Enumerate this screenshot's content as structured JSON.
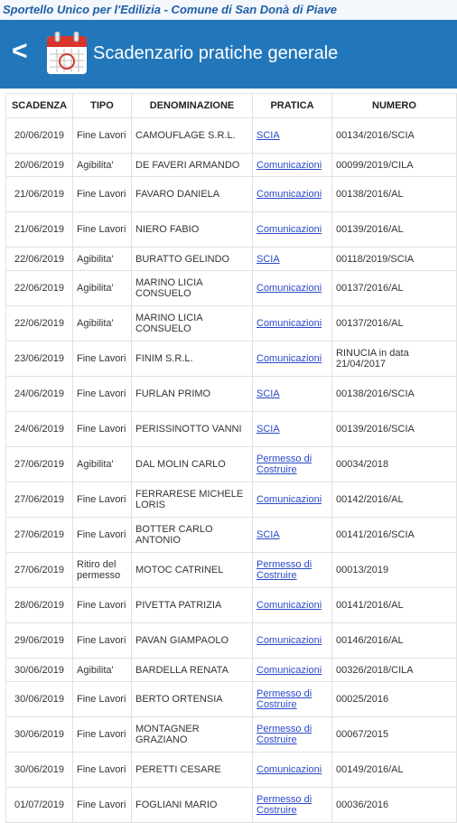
{
  "topbar": {
    "title": "Sportello Unico per l'Edilizia - Comune di San Donà di Piave"
  },
  "header": {
    "back_label": "<",
    "title": "Scadenzario pratiche generale"
  },
  "table": {
    "headers": [
      "SCADENZA",
      "TIPO",
      "DENOMINAZIONE",
      "PRATICA",
      "NUMERO"
    ],
    "rows": [
      {
        "scadenza": "20/06/2019",
        "tipo": "Fine Lavori",
        "denominazione": "CAMOUFLAGE S.R.L.",
        "pratica": "SCIA",
        "numero": "00134/2016/SCIA"
      },
      {
        "scadenza": "20/06/2019",
        "tipo": "Agibilita'",
        "denominazione": "DE FAVERI ARMANDO",
        "pratica": "Comunicazioni",
        "numero": "00099/2019/CILA"
      },
      {
        "scadenza": "21/06/2019",
        "tipo": "Fine Lavori",
        "denominazione": "FAVARO DANIELA",
        "pratica": "Comunicazioni",
        "numero": "00138/2016/AL"
      },
      {
        "scadenza": "21/06/2019",
        "tipo": "Fine Lavori",
        "denominazione": "NIERO FABIO",
        "pratica": "Comunicazioni",
        "numero": "00139/2016/AL"
      },
      {
        "scadenza": "22/06/2019",
        "tipo": "Agibilita'",
        "denominazione": "BURATTO GELINDO",
        "pratica": "SCIA",
        "numero": "00118/2019/SCIA"
      },
      {
        "scadenza": "22/06/2019",
        "tipo": "Agibilita'",
        "denominazione": "MARINO LICIA CONSUELO",
        "pratica": "Comunicazioni",
        "numero": "00137/2016/AL"
      },
      {
        "scadenza": "22/06/2019",
        "tipo": "Agibilita'",
        "denominazione": "MARINO LICIA CONSUELO",
        "pratica": "Comunicazioni",
        "numero": "00137/2016/AL"
      },
      {
        "scadenza": "23/06/2019",
        "tipo": "Fine Lavori",
        "denominazione": "FINIM S.R.L.",
        "pratica": "Comunicazioni",
        "numero": "RINUCIA in data 21/04/2017"
      },
      {
        "scadenza": "24/06/2019",
        "tipo": "Fine Lavori",
        "denominazione": "FURLAN PRIMO",
        "pratica": "SCIA",
        "numero": "00138/2016/SCIA"
      },
      {
        "scadenza": "24/06/2019",
        "tipo": "Fine Lavori",
        "denominazione": "PERISSINOTTO VANNI",
        "pratica": "SCIA",
        "numero": "00139/2016/SCIA"
      },
      {
        "scadenza": "27/06/2019",
        "tipo": "Agibilita'",
        "denominazione": "DAL MOLIN CARLO",
        "pratica": "Permesso di Costruire",
        "numero": "00034/2018"
      },
      {
        "scadenza": "27/06/2019",
        "tipo": "Fine Lavori",
        "denominazione": "FERRARESE MICHELE LORIS",
        "pratica": "Comunicazioni",
        "numero": "00142/2016/AL"
      },
      {
        "scadenza": "27/06/2019",
        "tipo": "Fine Lavori",
        "denominazione": "BOTTER CARLO ANTONIO",
        "pratica": "SCIA",
        "numero": "00141/2016/SCIA"
      },
      {
        "scadenza": "27/06/2019",
        "tipo": "Ritiro del permesso",
        "denominazione": "MOTOC CATRINEL",
        "pratica": "Permesso di Costruire",
        "numero": "00013/2019"
      },
      {
        "scadenza": "28/06/2019",
        "tipo": "Fine Lavori",
        "denominazione": "PIVETTA PATRIZIA",
        "pratica": "Comunicazioni",
        "numero": "00141/2016/AL"
      },
      {
        "scadenza": "29/06/2019",
        "tipo": "Fine Lavori",
        "denominazione": "PAVAN GIAMPAOLO",
        "pratica": "Comunicazioni",
        "numero": "00146/2016/AL"
      },
      {
        "scadenza": "30/06/2019",
        "tipo": "Agibilita'",
        "denominazione": "BARDELLA RENATA",
        "pratica": "Comunicazioni",
        "numero": "00326/2018/CILA"
      },
      {
        "scadenza": "30/06/2019",
        "tipo": "Fine Lavori",
        "denominazione": "BERTO ORTENSIA",
        "pratica": "Permesso di Costruire",
        "numero": "00025/2016"
      },
      {
        "scadenza": "30/06/2019",
        "tipo": "Fine Lavori",
        "denominazione": "MONTAGNER GRAZIANO",
        "pratica": "Permesso di Costruire",
        "numero": "00067/2015"
      },
      {
        "scadenza": "30/06/2019",
        "tipo": "Fine Lavori",
        "denominazione": "PERETTI CESARE",
        "pratica": "Comunicazioni",
        "numero": "00149/2016/AL"
      },
      {
        "scadenza": "01/07/2019",
        "tipo": "Fine Lavori",
        "denominazione": "FOGLIANI MARIO",
        "pratica": "Permesso di Costruire",
        "numero": "00036/2016"
      }
    ]
  },
  "colors": {
    "header_bg": "#2277bb",
    "link": "#2a49c9",
    "topbar_text": "#1f5fa8"
  },
  "icons": {
    "back": "back-arrow-icon",
    "calendar": "calendar-icon"
  }
}
